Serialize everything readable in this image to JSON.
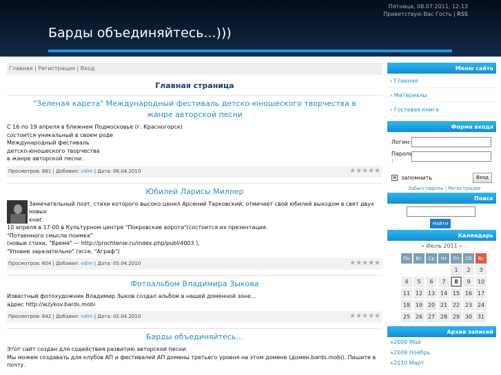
{
  "header": {
    "date": "Пятница, 08.07.2011, 12:13",
    "greeting": "Приветствую Вас Гость",
    "rss": "RSS",
    "title": "Барды объединяйтесь...)))"
  },
  "breadcrumb": {
    "home": "Главная",
    "register": "Регистрация",
    "login": "Вход"
  },
  "page_title": "Главная страница",
  "entries": [
    {
      "title": "\"Зеленая карета\" Международный фестиваль детско-юношеского творчества в жанре авторской песни",
      "body": [
        "С 16 по 19 апреля в ближнем Подмосковье (г. Красногорск)",
        "состоится уникальный в своем роде",
        "Международный фестиваль",
        "детско-юношеского творчества",
        "в жанре авторской песни."
      ],
      "views": "Просмотров: 661",
      "author_label": "Добавил:",
      "author": "vdim",
      "date": "Дата: 06.04.2010"
    },
    {
      "title": "Юбилей Ларисы Миллер",
      "body": [
        "Замечательный поэт, стихи которого высоко ценил Арсений Тарковский, отмечает свой юбилей выходом в свет двух новых",
        "книг.",
        "10 апреля в 17-00 в Культурном центре \"Покровские ворота\"(состоится их презентация.",
        "\"Потаенного смысла поимка\"",
        "(новые стихи, \"Время\" — http://prochtenie.ru/index.php/publ/4003 ),",
        "\"Уповие заразительно\" (эссе, \"Аграф\")"
      ],
      "views": "Просмотров: 604",
      "author_label": "Добавил:",
      "author": "vdim",
      "date": "Дата: 05.04.2010"
    },
    {
      "title": "Фотоальбом Владимира Зыкова",
      "body": [
        "Известный фотохудожник Владимир Зыков создал альбом в нашей доменной зоне...",
        "адрес http://wzykov.bards.mobi"
      ],
      "views": "Просмотров: 642",
      "author_label": "Добавил:",
      "author": "vdim",
      "date": "Дата: 02.04.2010"
    },
    {
      "title": "Барды объединяйтесь...",
      "body": [
        "Этот сайт создан для содействия развитию авторской песни.",
        "Мы можем создавать для клубов АП и фестивалей АП домены третьего уровня на этом домене (домен.bards.mobi). Пишите в",
        "почту."
      ]
    }
  ],
  "sidebar": {
    "menu_title": "Меню сайта",
    "menu": [
      "Главная",
      "Материалы",
      "Гостевая книга"
    ],
    "login_title": "Форма входа",
    "login_label": "Логин:",
    "password_label": "Пароль",
    "password_colon": ":",
    "remember": "запомнить",
    "login_btn": "Вход",
    "forgot": "Забыл пароль",
    "register": "Регистрация",
    "search_title": "Поиск",
    "search_btn": "Найти",
    "calendar_title": "Календарь",
    "calendar_prev": "«",
    "calendar_month": "Июль 2011",
    "calendar_next": "»",
    "weekdays": [
      "Пн",
      "Вт",
      "Ср",
      "Чт",
      "Пт",
      "Сб",
      "Вс"
    ],
    "weeks": [
      [
        "",
        "",
        "",
        "",
        "1",
        "2",
        "3"
      ],
      [
        "4",
        "5",
        "6",
        "7",
        "8",
        "9",
        "10"
      ],
      [
        "11",
        "12",
        "13",
        "14",
        "15",
        "16",
        "17"
      ],
      [
        "18",
        "19",
        "20",
        "21",
        "22",
        "23",
        "24"
      ],
      [
        "25",
        "26",
        "27",
        "28",
        "29",
        "30",
        "31"
      ]
    ],
    "today": "8",
    "archive_title": "Архив записей",
    "archive": [
      "2009 Май",
      "2009 Ноябрь",
      "2010 Март"
    ]
  }
}
